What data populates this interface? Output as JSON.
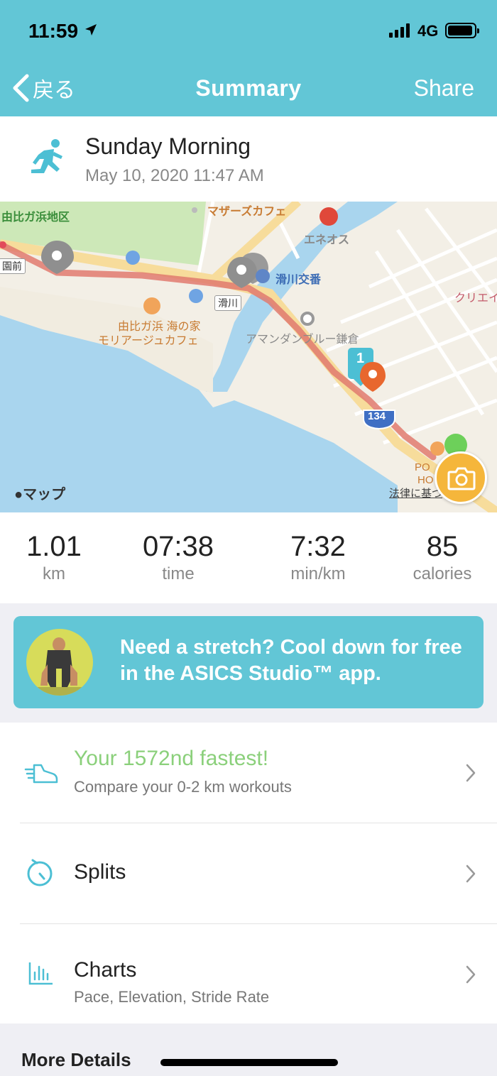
{
  "status_bar": {
    "time": "11:59",
    "network": "4G"
  },
  "nav": {
    "back_label": "戻る",
    "title": "Summary",
    "share_label": "Share"
  },
  "activity": {
    "title": "Sunday Morning",
    "date": "May 10, 2020 11:47 AM"
  },
  "map": {
    "labels": {
      "yuigahama_district": "由比ガ浜地区",
      "mother_cafe": "マザーズカフェ",
      "eneos": "エネオス",
      "namerikawa_koban": "滑川交番",
      "namerikawa": "滑川",
      "park_front": "園前",
      "umi_no_ie": "由比ガ浜 海の家",
      "moriaju_cafe": "モリアージュカフェ",
      "amanda": "アマンダンブルー鎌倉",
      "creation": "クリエイ",
      "route_134": "134",
      "km_marker": "1",
      "po": "PO",
      "ho": "HO"
    },
    "brand": "マップ",
    "legal": "法律に基づ"
  },
  "stats": [
    {
      "value": "1.01",
      "unit": "km"
    },
    {
      "value": "07:38",
      "unit": "time"
    },
    {
      "value": "7:32",
      "unit": "min/km"
    },
    {
      "value": "85",
      "unit": "calories"
    }
  ],
  "promo": {
    "text": "Need a stretch? Cool down for free in the ASICS Studio™ app."
  },
  "rows": {
    "fastest": {
      "title": "Your 1572nd fastest!",
      "subtitle": "Compare your 0-2 km workouts"
    },
    "splits": {
      "title": "Splits"
    },
    "charts": {
      "title": "Charts",
      "subtitle": "Pace, Elevation, Stride Rate"
    }
  },
  "more": {
    "title": "More Details"
  },
  "colors": {
    "brand_teal": "#62c6d6",
    "accent_green": "#8bd07b",
    "camera_orange": "#f5b63b",
    "route_red": "#e07a6e"
  }
}
